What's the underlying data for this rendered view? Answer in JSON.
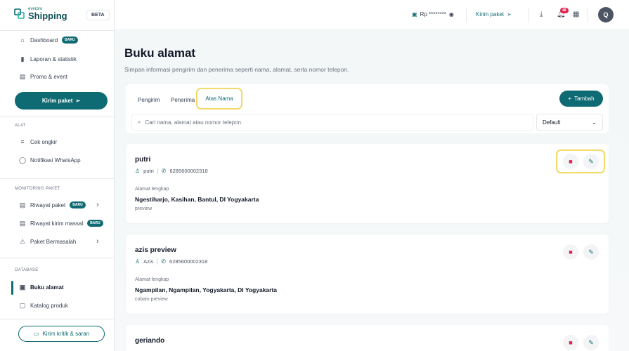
{
  "brand": {
    "small": "everpro",
    "name": "Shipping",
    "beta": "BETA"
  },
  "sidebar": {
    "top_items": [
      {
        "label": "Dashboard",
        "badge": "BARU",
        "icon": "home-icon"
      },
      {
        "label": "Laporan & statistik",
        "icon": "bar-chart-icon"
      },
      {
        "label": "Promo & event",
        "icon": "promo-icon"
      }
    ],
    "kirim_label": "Kirim paket",
    "sections": {
      "alat": "ALAT",
      "monitoring": "MONITORING PAKET",
      "database": "DATABASE"
    },
    "alat_items": [
      {
        "label": "Cek ongkir",
        "icon": "cek-ongkir-icon"
      },
      {
        "label": "Notifikasi WhatsApp",
        "icon": "whatsapp-icon"
      }
    ],
    "monitoring_items": [
      {
        "label": "Riwayat paket",
        "badge": "BARU"
      },
      {
        "label": "Riwayat kirim massal",
        "badge": "BARU"
      },
      {
        "label": "Paket Bermasalah"
      }
    ],
    "database_items": [
      {
        "label": "Buku alamat",
        "active": true
      },
      {
        "label": "Katalog produk"
      }
    ],
    "kritik_label": "Kirim kritik & saran"
  },
  "topbar": {
    "saldo": "Rp ********",
    "kirim_label": "Kirim paket",
    "notif_count": "48",
    "avatar": "Q"
  },
  "page": {
    "title": "Buku alamat",
    "subtitle": "Simpan informasi pengirim dan penerima seperti nama, alamat, serta nomor telepon."
  },
  "tabs": [
    "Pengirim",
    "Penerima",
    "Atas Nama"
  ],
  "active_tab": "Atas Nama",
  "tambah_label": "Tambah",
  "search": {
    "placeholder": "Cari nama, alamat atau nomor telepon"
  },
  "sort": {
    "value": "Default"
  },
  "contacts": [
    {
      "name": "putri",
      "alias": "putri",
      "phone": "6285600002318",
      "address_label": "Alamat lengkap",
      "address": "Ngestiharjo, Kasihan, Bantul, DI Yogyakarta",
      "note": "preview"
    },
    {
      "name": "azis preview",
      "alias": "Azis",
      "phone": "6285600002318",
      "address_label": "Alamat lengkap",
      "address": "Ngampilan, Ngampilan, Yogyakarta, DI Yogyakarta",
      "note": "cobain preview"
    },
    {
      "name": "geriando"
    }
  ],
  "colors": {
    "primary": "#0f6b73",
    "highlight": "#f2d96a",
    "danger": "#dc2650"
  }
}
